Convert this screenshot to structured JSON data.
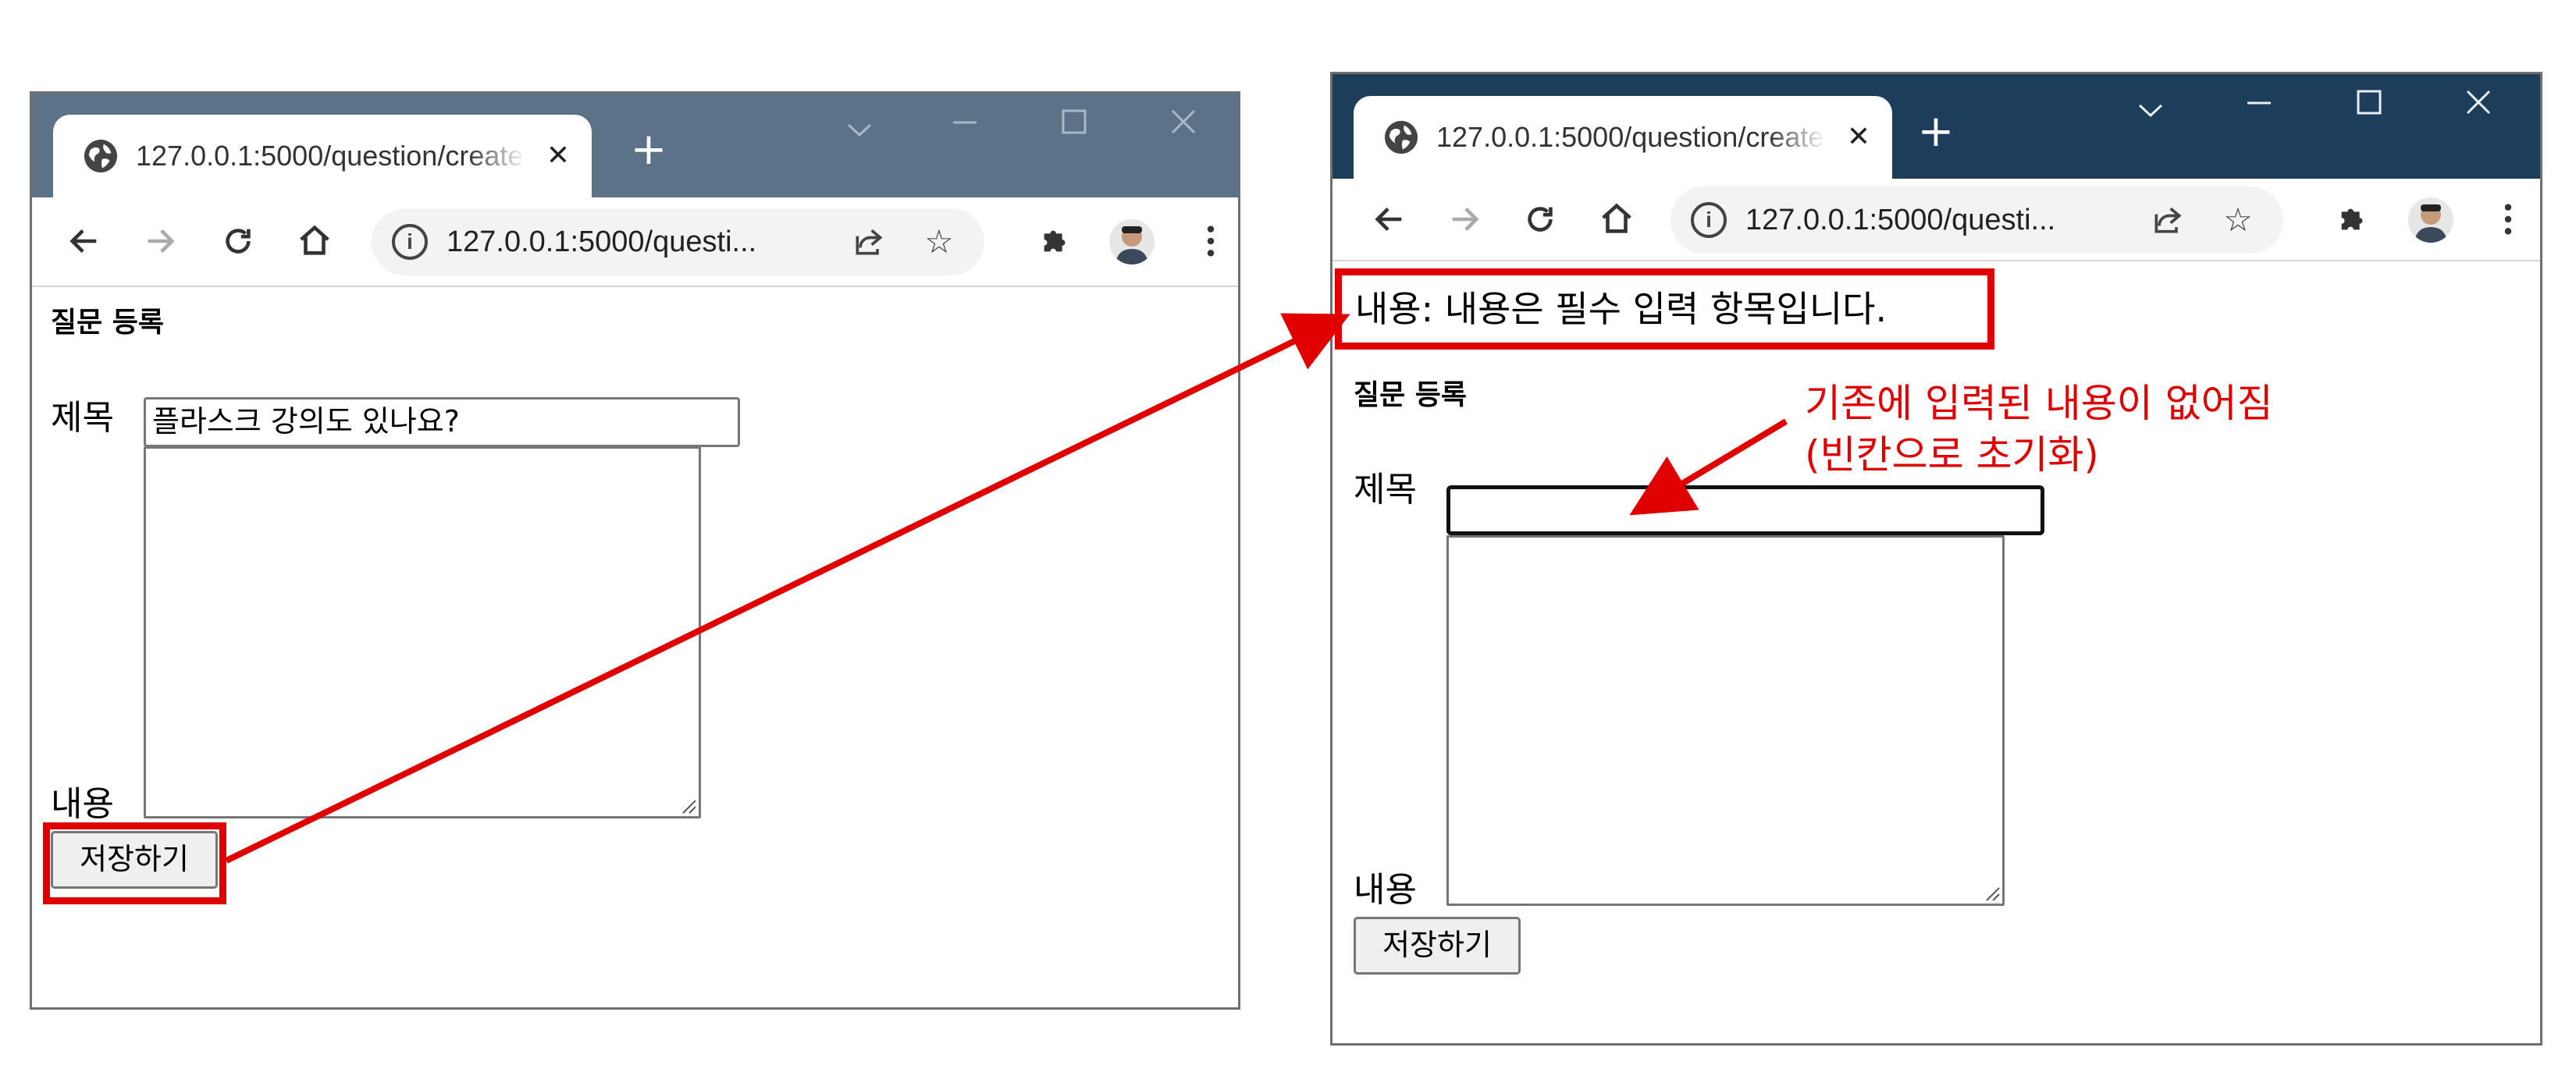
{
  "left_window": {
    "tab_title": "127.0.0.1:5000/question/create",
    "url": "127.0.0.1:5000/questi...",
    "page": {
      "heading": "질문 등록",
      "subject_label": "제목",
      "subject_value": "플라스크 강의도 있나요?",
      "content_label": "내용",
      "content_value": "",
      "save_button": "저장하기"
    }
  },
  "right_window": {
    "tab_title": "127.0.0.1:5000/question/create",
    "url": "127.0.0.1:5000/questi...",
    "page": {
      "error_message": "내용: 내용은 필수 입력 항목입니다.",
      "heading": "질문 등록",
      "subject_label": "제목",
      "subject_value": "",
      "content_label": "내용",
      "content_value": "",
      "save_button": "저장하기"
    }
  },
  "annotation": {
    "line1": "기존에 입력된 내용이 없어짐",
    "line2": "(빈칸으로 초기화)",
    "color": "#e00000"
  },
  "colors": {
    "left_titlebar": "#5b7288",
    "right_titlebar": "#1d3e5a",
    "highlight": "#e00000"
  },
  "icons": {
    "tab_favicon": "globe-icon",
    "tab_close": "close-icon",
    "new_tab": "plus-icon",
    "back": "arrow-left-icon",
    "forward": "arrow-right-icon",
    "reload": "reload-icon",
    "home": "home-icon",
    "site_info": "info-icon",
    "share": "share-icon",
    "bookmark": "star-icon",
    "extensions": "puzzle-icon",
    "profile": "avatar",
    "menu": "kebab-menu-icon",
    "tab_search": "chevron-down-icon",
    "minimize": "minimize-icon",
    "maximize": "maximize-icon",
    "close_window": "close-icon"
  }
}
